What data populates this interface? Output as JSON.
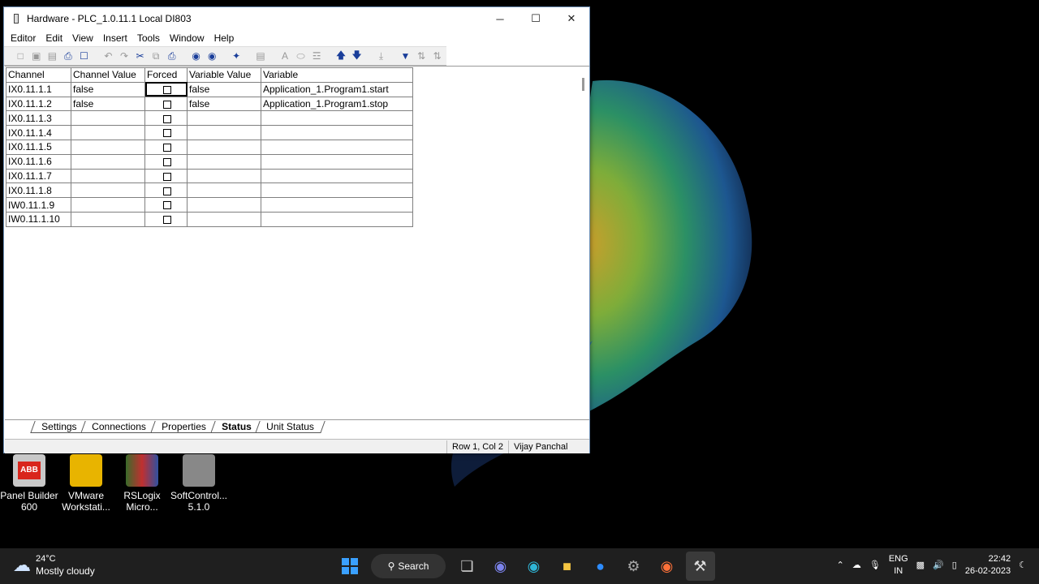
{
  "window": {
    "title": "Hardware - PLC_1.0.11.1  Local  DI803",
    "minimize": "─",
    "maximize": "☐",
    "close": "✕"
  },
  "menu": [
    "Editor",
    "Edit",
    "View",
    "Insert",
    "Tools",
    "Window",
    "Help"
  ],
  "table": {
    "headers": [
      "Channel",
      "Channel Value",
      "Forced",
      "Variable Value",
      "Variable"
    ],
    "rows": [
      {
        "channel": "IX0.11.1.1",
        "channel_value": "false",
        "variable_value": "false",
        "variable": "Application_1.Program1.start"
      },
      {
        "channel": "IX0.11.1.2",
        "channel_value": "false",
        "variable_value": "false",
        "variable": "Application_1.Program1.stop"
      },
      {
        "channel": "IX0.11.1.3",
        "channel_value": "",
        "variable_value": "",
        "variable": ""
      },
      {
        "channel": "IX0.11.1.4",
        "channel_value": "",
        "variable_value": "",
        "variable": ""
      },
      {
        "channel": "IX0.11.1.5",
        "channel_value": "",
        "variable_value": "",
        "variable": ""
      },
      {
        "channel": "IX0.11.1.6",
        "channel_value": "",
        "variable_value": "",
        "variable": ""
      },
      {
        "channel": "IX0.11.1.7",
        "channel_value": "",
        "variable_value": "",
        "variable": ""
      },
      {
        "channel": "IX0.11.1.8",
        "channel_value": "",
        "variable_value": "",
        "variable": ""
      },
      {
        "channel": "IW0.11.1.9",
        "channel_value": "",
        "variable_value": "",
        "variable": ""
      },
      {
        "channel": "IW0.11.1.10",
        "channel_value": "",
        "variable_value": "",
        "variable": ""
      }
    ]
  },
  "tabs": [
    "Settings",
    "Connections",
    "Properties",
    "Status",
    "Unit Status"
  ],
  "active_tab": "Status",
  "status": {
    "position": "Row 1, Col 2",
    "user": "Vijay Panchal"
  },
  "desktop_icons": [
    {
      "label1": "Panel Builder",
      "label2": "600",
      "color": "#d9261c"
    },
    {
      "label1": "VMware",
      "label2": "Workstati...",
      "color": "#e8b400"
    },
    {
      "label1": "RSLogix",
      "label2": "Micro...",
      "color": "#4a7b3a"
    },
    {
      "label1": "SoftControl...",
      "label2": "5.1.0",
      "color": "#777777"
    }
  ],
  "taskbar": {
    "weather_temp": "24°C",
    "weather_desc": "Mostly cloudy",
    "search": "Search",
    "lang1": "ENG",
    "lang2": "IN",
    "time": "22:42",
    "date": "26-02-2023"
  }
}
